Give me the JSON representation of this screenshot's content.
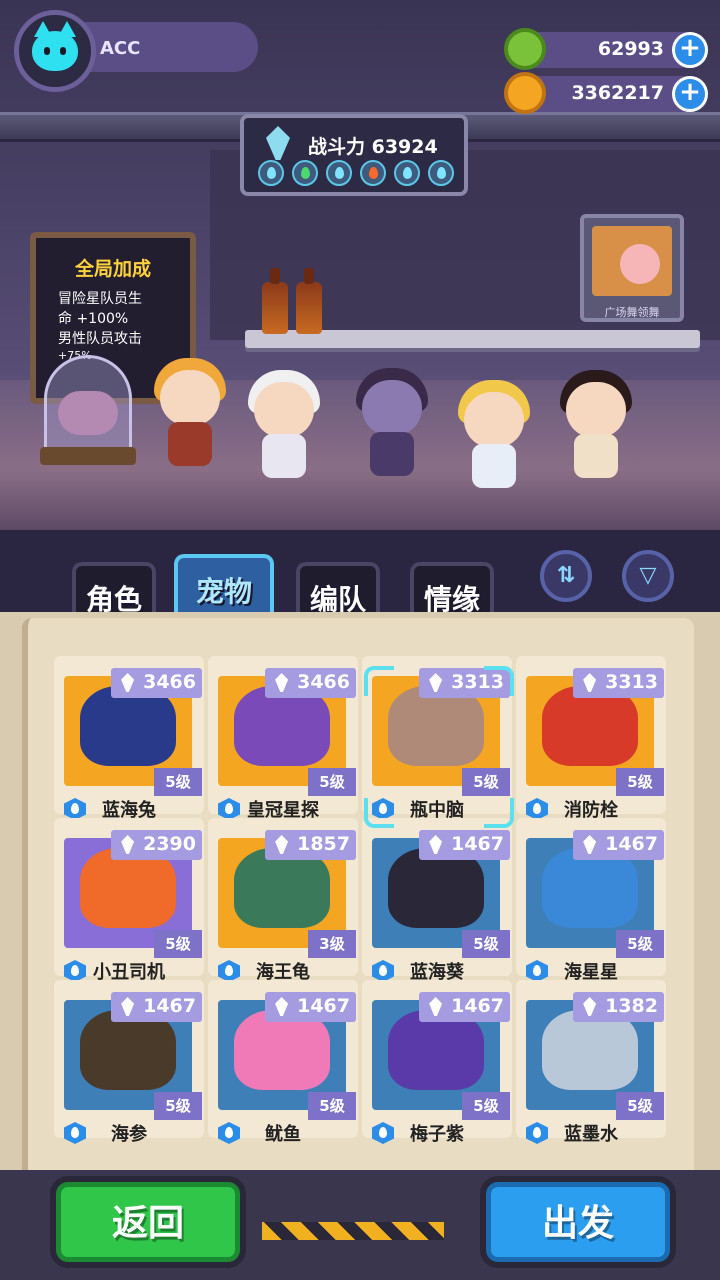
{
  "player": {
    "name": "ACC",
    "avatar_icon": "cat-face-icon"
  },
  "currency": [
    {
      "icon": "donut-coin-icon",
      "value": "62993"
    },
    {
      "icon": "planet-coin-icon",
      "value": "3362217"
    }
  ],
  "combat_power": {
    "label": "战斗力 63924"
  },
  "bonus_board": {
    "title": "全局加成",
    "line1": "冒险星队员生",
    "line2": "命 +100%",
    "line3": "男性队员攻击",
    "line4": "+75%"
  },
  "tv": {
    "label": "广场舞领舞"
  },
  "tabs": [
    {
      "label": "角色",
      "active": false
    },
    {
      "label": "宠物",
      "active": true
    },
    {
      "label": "编队",
      "active": false
    },
    {
      "label": "情缘",
      "active": false
    }
  ],
  "pets": [
    {
      "name": "蓝海兔",
      "power": "3466",
      "level": "5级",
      "bg": "orange"
    },
    {
      "name": "皇冠星探",
      "power": "3466",
      "level": "5级",
      "bg": "orange"
    },
    {
      "name": "瓶中脑",
      "power": "3313",
      "level": "5级",
      "bg": "orange"
    },
    {
      "name": "消防栓",
      "power": "3313",
      "level": "5级",
      "bg": "orange"
    },
    {
      "name": "小丑司机",
      "power": "2390",
      "level": "5级",
      "bg": "purple"
    },
    {
      "name": "海王龟",
      "power": "1857",
      "level": "3级",
      "bg": "orange"
    },
    {
      "name": "蓝海葵",
      "power": "1467",
      "level": "5级",
      "bg": "blue"
    },
    {
      "name": "海星星",
      "power": "1467",
      "level": "5级",
      "bg": "blue"
    },
    {
      "name": "海参",
      "power": "1467",
      "level": "5级",
      "bg": "blue"
    },
    {
      "name": "鱿鱼",
      "power": "1467",
      "level": "5级",
      "bg": "blue"
    },
    {
      "name": "梅子紫",
      "power": "1467",
      "level": "5级",
      "bg": "blue"
    },
    {
      "name": "蓝墨水",
      "power": "1382",
      "level": "5级",
      "bg": "blue"
    }
  ],
  "buttons": {
    "back": "返回",
    "go": "出发"
  },
  "colors": {
    "accent": "#2b9ef0",
    "green": "#2fc64a",
    "tab_active": "#2e5fa0"
  }
}
